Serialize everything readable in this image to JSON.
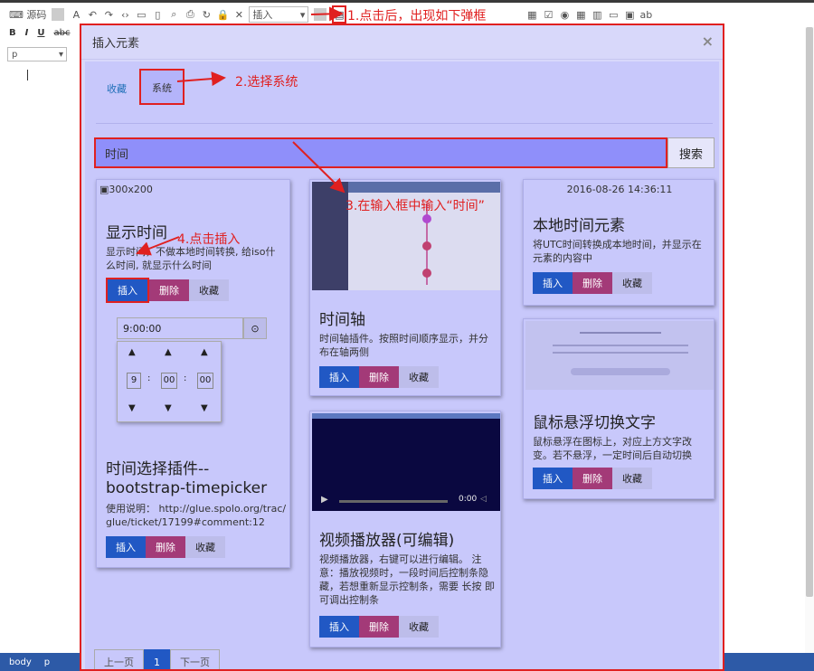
{
  "toolbar": {
    "source_label": "源码",
    "insert_select": "插入",
    "format_select": "p",
    "bold": "B",
    "italic": "I",
    "underline": "U",
    "strike": "abc",
    "sup": "x",
    "clear": "Tx"
  },
  "modal": {
    "title": "插入元素",
    "close": "×",
    "tabs": [
      "收藏",
      "系统"
    ],
    "search_value": "时间",
    "search_button": "搜索"
  },
  "cards": [
    {
      "img_alt": "300x200",
      "title": "显示时间",
      "desc": "显示时间，不做本地时间转换, 给iso什么时间, 就显示什么时间"
    },
    {
      "title": "时间选择插件--bootstrap-timepicker",
      "desc": "使用说明： http://glue.spolo.org/trac/glue/ticket/17199#comment:12",
      "time_value": "9:00:00",
      "hour": "9",
      "minute": "00",
      "second": "00"
    },
    {
      "title": "时间轴",
      "desc": "时间轴插件。按照时间顺序显示，并分布在轴两侧"
    },
    {
      "title": "视频播放器(可编辑)",
      "desc": "视频播放器，右键可以进行编辑。 注意：播放视频时，一段时间后控制条隐藏，若想重新显示控制条，需要 长按 即可调出控制条",
      "video_time": "0:00"
    },
    {
      "timestamp": "2016-08-26 14:36:11",
      "title": "本地时间元素",
      "desc": "将UTC时间转换成本地时间，并显示在元素的内容中"
    },
    {
      "title": "鼠标悬浮切换文字",
      "desc": "鼠标悬浮在图标上，对应上方文字改变。若不悬浮，一定时间后自动切换"
    }
  ],
  "buttons": {
    "insert": "插入",
    "delete": "删除",
    "favorite": "收藏"
  },
  "pager": {
    "prev": "上一页",
    "page": "1",
    "next": "下一页"
  },
  "annotations": {
    "a1": "1.点击后，出现如下弹框",
    "a2": "2.选择系统",
    "a3": "3.在输入框中输入“时间”",
    "a4": "4.点击插入"
  },
  "status": {
    "body": "body",
    "p": "p"
  }
}
